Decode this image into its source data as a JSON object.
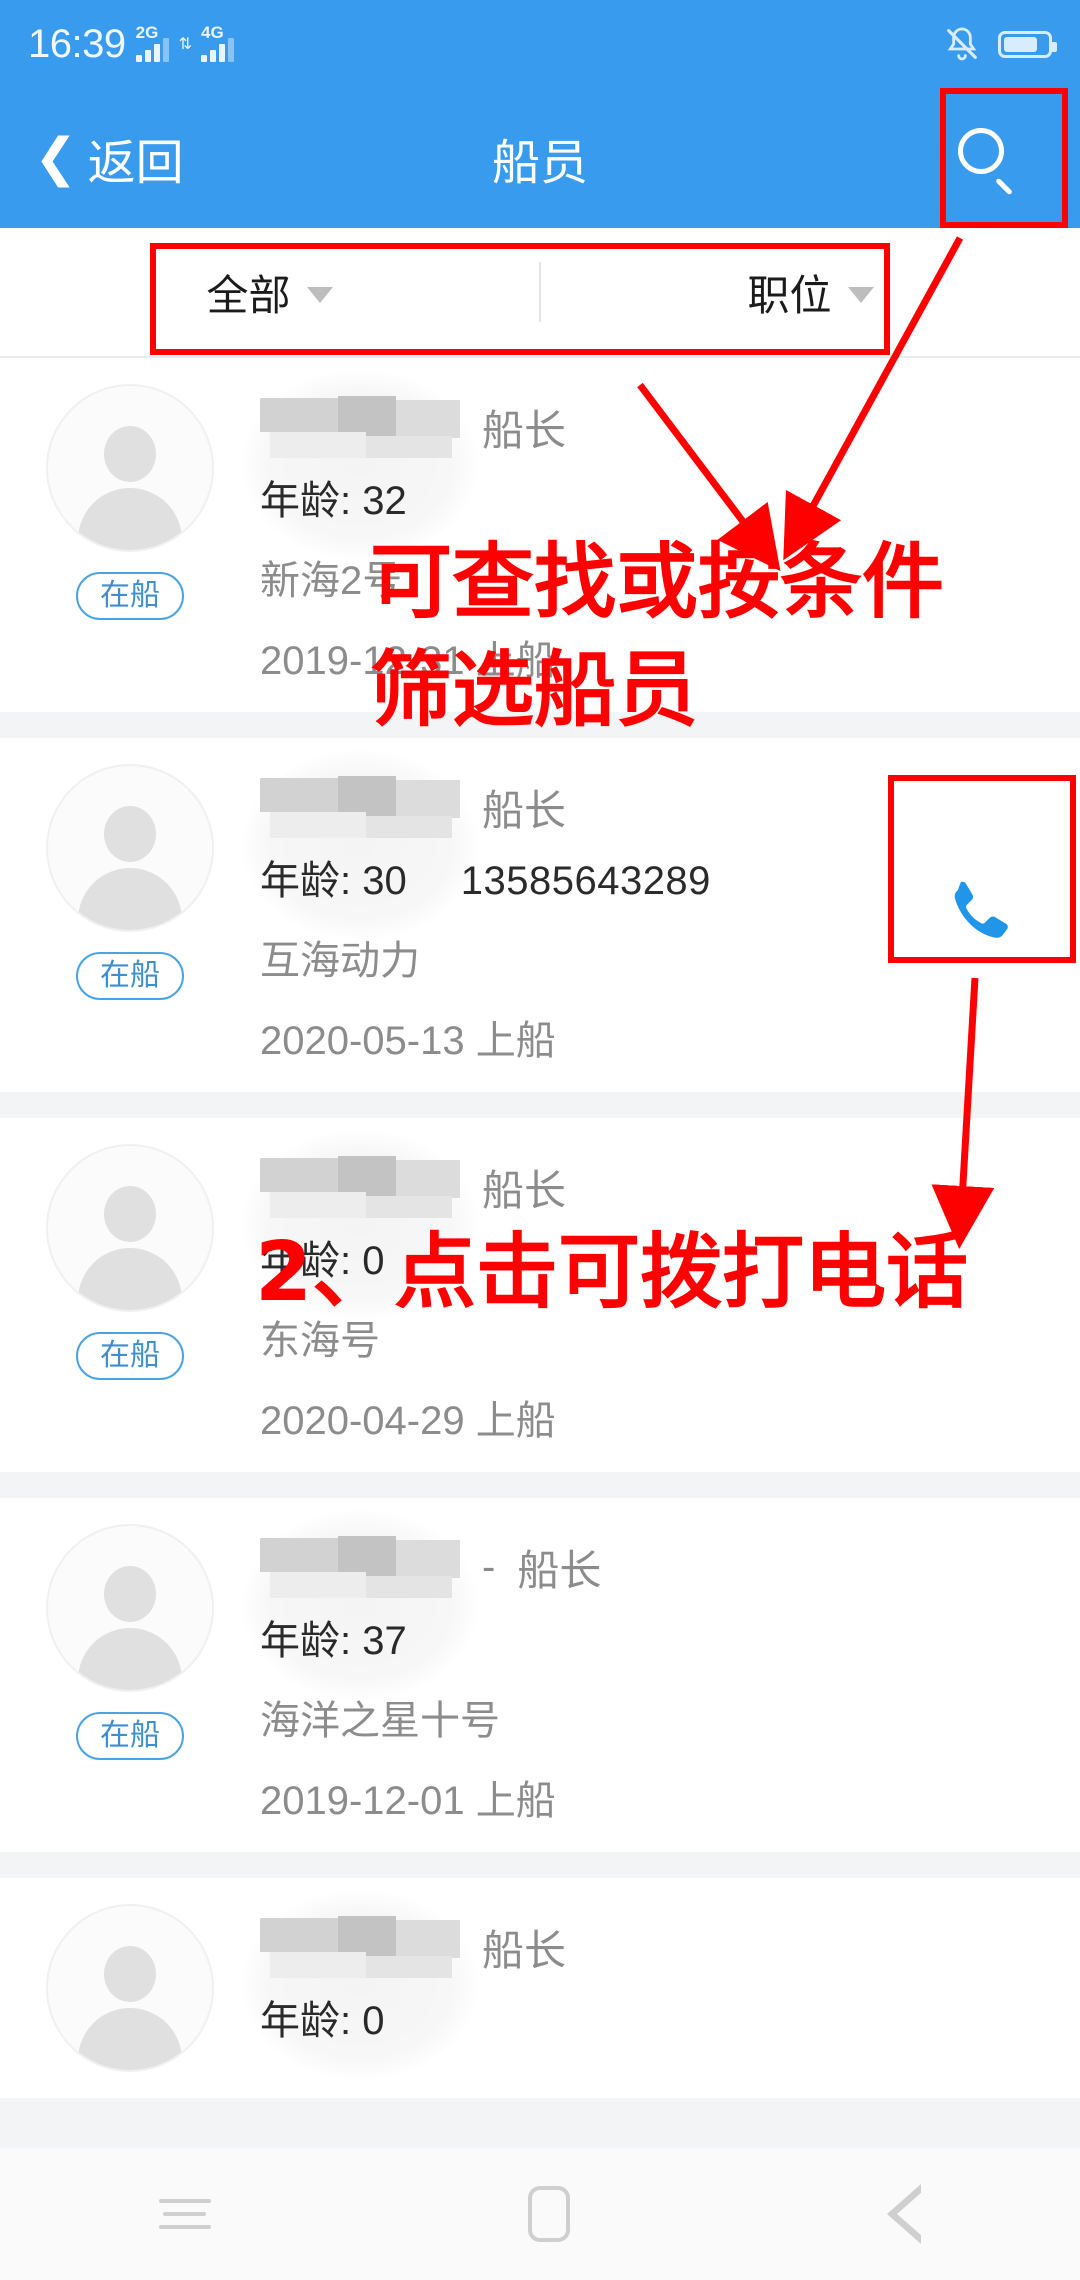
{
  "status_bar": {
    "time": "16:39",
    "network_1": "2G",
    "network_2": "4G",
    "mute_icon": "bell-muted-icon",
    "battery_icon": "battery-icon"
  },
  "header": {
    "back_label": "返回",
    "title": "船员",
    "search_icon": "search-icon"
  },
  "filters": [
    {
      "label": "全部",
      "caret": "chevron-down-icon"
    },
    {
      "label": "职位",
      "caret": "chevron-down-icon"
    }
  ],
  "labels": {
    "age_prefix": "年龄:",
    "board_suffix": "上船",
    "onboard_badge": "在船",
    "phone_icon": "phone-icon",
    "avatar_icon": "avatar-placeholder-icon"
  },
  "crew": [
    {
      "name_masked": "",
      "role": "船长",
      "age": "年龄: 32",
      "phone": "",
      "ship": "新海2号",
      "date": "2019-12-31 上船",
      "status": "在船",
      "has_call": false
    },
    {
      "name_masked": "",
      "role": "船长",
      "age": "年龄: 30",
      "phone": "13585643289",
      "ship": "互海动力",
      "date": "2020-05-13 上船",
      "status": "在船",
      "has_call": true
    },
    {
      "name_masked": "",
      "role": "船长",
      "age": "年龄: 0",
      "phone": "",
      "ship": "东海号",
      "date": "2020-04-29 上船",
      "status": "在船",
      "has_call": false
    },
    {
      "name_masked": "-",
      "role": "船长",
      "age": "年龄: 37",
      "phone": "",
      "ship": "海洋之星十号",
      "date": "2019-12-01 上船",
      "status": "在船",
      "has_call": false
    },
    {
      "name_masked": "",
      "role": "船长",
      "age": "年龄: 0",
      "phone": "",
      "ship": "",
      "date": "",
      "status": "",
      "has_call": false
    }
  ],
  "annotations": {
    "note1_line1": "可查找或按条件",
    "note1_line2": "筛选船员",
    "note2": "2、点击可拨打电话"
  },
  "system_nav": {
    "recent_icon": "menu-icon",
    "home_icon": "home-square-icon",
    "back_icon": "back-triangle-icon"
  },
  "colors": {
    "brand_blue": "#389bee",
    "annotation_red": "#ff0000",
    "badge_blue": "#4ba3e3",
    "phone_icon_blue": "#2196e8"
  }
}
